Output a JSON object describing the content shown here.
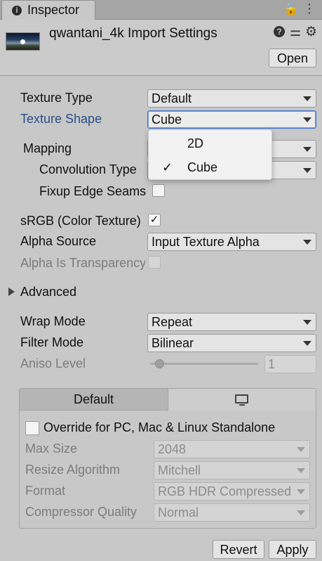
{
  "tab": {
    "label": "Inspector"
  },
  "header": {
    "title": "qwantani_4k Import Settings",
    "open_label": "Open"
  },
  "fields": {
    "texture_type": {
      "label": "Texture Type",
      "value": "Default"
    },
    "texture_shape": {
      "label": "Texture Shape",
      "value": "Cube"
    },
    "mapping": {
      "label": "Mapping",
      "value": ""
    },
    "convolution_type": {
      "label": "Convolution Type",
      "value": ""
    },
    "fixup_edge_seams": {
      "label": "Fixup Edge Seams",
      "checked": false
    },
    "srgb": {
      "label": "sRGB (Color Texture)",
      "checked": true
    },
    "alpha_source": {
      "label": "Alpha Source",
      "value": "Input Texture Alpha"
    },
    "alpha_is_transparency": {
      "label": "Alpha Is Transparency",
      "checked": false
    },
    "advanced": {
      "label": "Advanced"
    },
    "wrap_mode": {
      "label": "Wrap Mode",
      "value": "Repeat"
    },
    "filter_mode": {
      "label": "Filter Mode",
      "value": "Bilinear"
    },
    "aniso_level": {
      "label": "Aniso Level",
      "value": "1"
    }
  },
  "shape_popup": {
    "options": [
      {
        "label": "2D",
        "selected": false
      },
      {
        "label": "Cube",
        "selected": true
      }
    ],
    "check_glyph": "✓"
  },
  "platform": {
    "tabs": {
      "default_label": "Default",
      "standalone_icon": "monitor-icon"
    },
    "override": {
      "label": "Override for PC, Mac & Linux Standalone",
      "checked": false
    },
    "max_size": {
      "label": "Max Size",
      "value": "2048"
    },
    "resize_algorithm": {
      "label": "Resize Algorithm",
      "value": "Mitchell"
    },
    "format": {
      "label": "Format",
      "value": "RGB HDR Compressed"
    },
    "compressor_quality": {
      "label": "Compressor Quality",
      "value": "Normal"
    }
  },
  "footer": {
    "revert_label": "Revert",
    "apply_label": "Apply"
  },
  "glyphs": {
    "check": "✓",
    "lock": "🔓",
    "kebab": "⋮",
    "preset": "⚌",
    "gear": "⚙",
    "help": "?",
    "info": "i"
  },
  "colors": {
    "accent_blue": "#2a4f8a",
    "focus_border": "#3a72c9"
  }
}
